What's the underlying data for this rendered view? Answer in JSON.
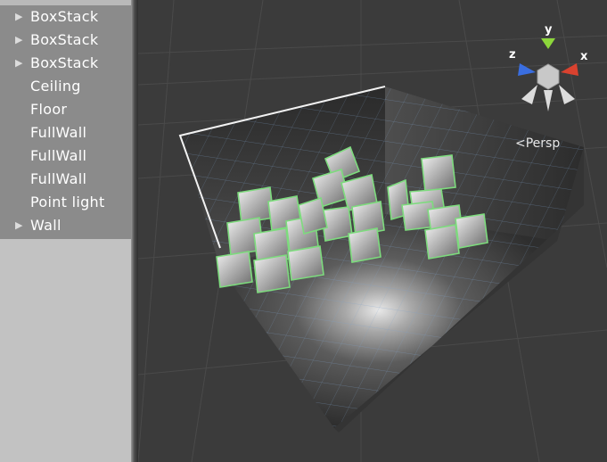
{
  "hierarchy": {
    "items": [
      {
        "label": "BoxStack",
        "has_children": true
      },
      {
        "label": "BoxStack",
        "has_children": true
      },
      {
        "label": "BoxStack",
        "has_children": true
      },
      {
        "label": "Ceiling",
        "has_children": false
      },
      {
        "label": "Floor",
        "has_children": false
      },
      {
        "label": "FullWall",
        "has_children": false
      },
      {
        "label": "FullWall",
        "has_children": false
      },
      {
        "label": "FullWall",
        "has_children": false
      },
      {
        "label": "Point light",
        "has_children": false
      },
      {
        "label": "Wall",
        "has_children": true
      }
    ],
    "expand_glyph": "▶"
  },
  "scene": {
    "projection_label": "Persp",
    "gizmo": {
      "x": "x",
      "y": "y",
      "z": "z"
    },
    "colors": {
      "background": "#3b3b3b",
      "selection_outline": "#7ddb7d",
      "x_axis": "#d9422f",
      "y_axis": "#8cd63b",
      "z_axis": "#3a6ee0"
    }
  }
}
